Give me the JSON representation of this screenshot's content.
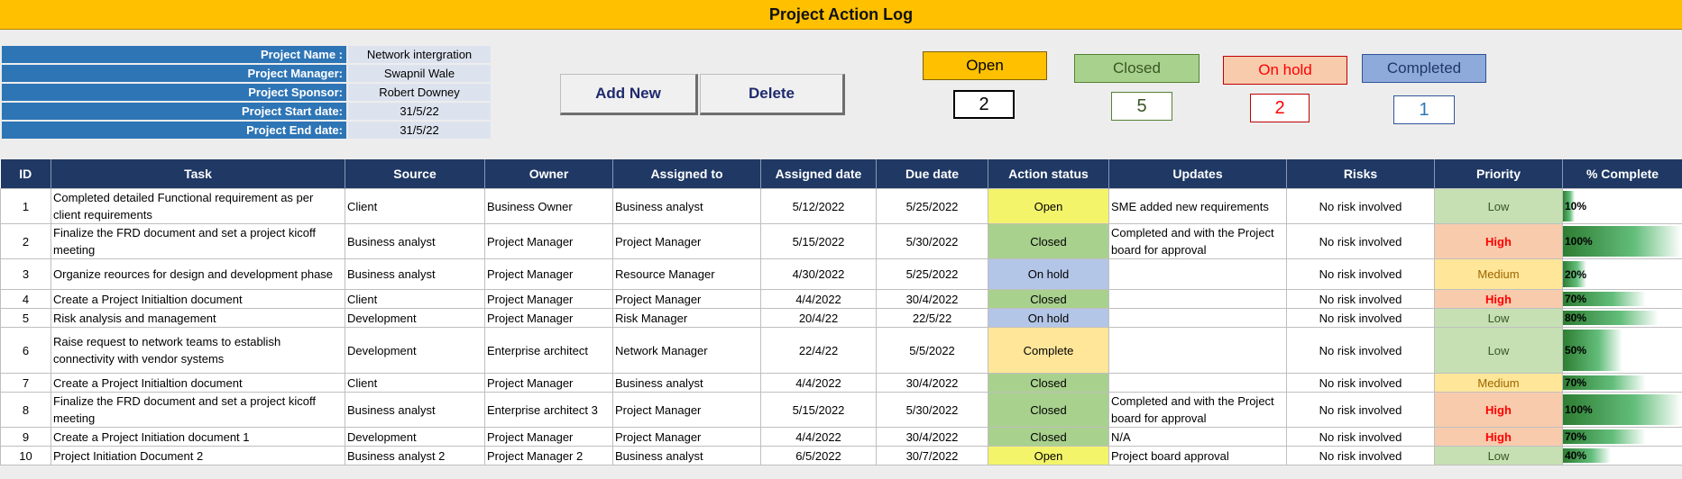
{
  "title": "Project Action Log",
  "info": [
    {
      "label": "Project Name :",
      "value": "Network intergration"
    },
    {
      "label": "Project Manager:",
      "value": "Swapnil Wale"
    },
    {
      "label": "Project Sponsor:",
      "value": "Robert Downey"
    },
    {
      "label": "Project Start  date:",
      "value": "31/5/22"
    },
    {
      "label": "Project End date:",
      "value": "31/5/22"
    }
  ],
  "buttons": {
    "add": "Add New",
    "delete": "Delete"
  },
  "stats": {
    "open": {
      "label": "Open",
      "count": "2",
      "bg": "#ffc000",
      "color": "#000000"
    },
    "closed": {
      "label": "Closed",
      "count": "5",
      "bg": "#a9d18e",
      "color": "#375623"
    },
    "onhold": {
      "label": "On hold",
      "count": "2",
      "bg": "#f8cbad",
      "color": "#ff0000"
    },
    "completed": {
      "label": "Completed",
      "count": "1",
      "bg": "#8eaadb",
      "color": "#2e75b6"
    }
  },
  "columns": [
    "ID",
    "Task",
    "Source",
    "Owner",
    "Assigned to",
    "Assigned date",
    "Due date",
    "Action status",
    "Updates",
    "Risks",
    "Priority",
    "% Complete"
  ],
  "rows": [
    {
      "id": "1",
      "task": "Completed detailed Functional requirement as per client requirements",
      "source": "Client",
      "owner": "Business Owner",
      "assigned": "Business analyst",
      "adate": "5/12/2022",
      "due": "5/25/2022",
      "status": "Open",
      "updates": "SME added new requirements",
      "risks": "No risk involved",
      "priority": "Low",
      "pct": "10%",
      "pval": 10
    },
    {
      "id": "2",
      "task": "Finalize the FRD document and set a project kicoff meeting",
      "source": "Business analyst",
      "owner": "Project Manager",
      "assigned": "Project Manager",
      "adate": "5/15/2022",
      "due": "5/30/2022",
      "status": "Closed",
      "updates": "Completed and with the Project board for approval",
      "risks": "No risk involved",
      "priority": "High",
      "pct": "100%",
      "pval": 100
    },
    {
      "id": "3",
      "task": "Organize reources for design and development phase",
      "source": "Business analyst",
      "owner": "Project Manager",
      "assigned": "Resource Manager",
      "adate": "4/30/2022",
      "due": "5/25/2022",
      "status": "On hold",
      "updates": "",
      "risks": "No risk involved",
      "priority": "Medium",
      "pct": "20%",
      "pval": 20
    },
    {
      "id": "4",
      "task": "Create a Project Initialtion document",
      "source": "Client",
      "owner": "Project Manager",
      "assigned": "Project Manager",
      "adate": "4/4/2022",
      "due": "30/4/2022",
      "status": "Closed",
      "updates": "",
      "risks": "No risk involved",
      "priority": "High",
      "pct": "70%",
      "pval": 70
    },
    {
      "id": "5",
      "task": "Risk analysis and  management",
      "source": "Development",
      "owner": "Project Manager",
      "assigned": "Risk Manager",
      "adate": "20/4/22",
      "due": "22/5/22",
      "status": "On hold",
      "updates": "",
      "risks": "No risk involved",
      "priority": "Low",
      "pct": "80%",
      "pval": 80
    },
    {
      "id": "6",
      "task": "Raise request to network teams to establish connectivity with vendor systems",
      "source": "Development",
      "owner": "Enterprise architect",
      "assigned": "Network Manager",
      "adate": "22/4/22",
      "due": "5/5/2022",
      "status": "Complete",
      "updates": "",
      "risks": "No risk involved",
      "priority": "Low",
      "pct": "50%",
      "pval": 50
    },
    {
      "id": "7",
      "task": "Create a Project Initialtion document",
      "source": "Client",
      "owner": "Project Manager",
      "assigned": "Business analyst",
      "adate": "4/4/2022",
      "due": "30/4/2022",
      "status": "Closed",
      "updates": "",
      "risks": "No risk involved",
      "priority": "Medium",
      "pct": "70%",
      "pval": 70
    },
    {
      "id": "8",
      "task": "Finalize the FRD document and set a project kicoff meeting",
      "source": "Business analyst",
      "owner": "Enterprise architect 3",
      "assigned": "Project Manager",
      "adate": "5/15/2022",
      "due": "5/30/2022",
      "status": "Closed",
      "updates": "Completed and with the Project board for approval",
      "risks": "No risk involved",
      "priority": "High",
      "pct": "100%",
      "pval": 100
    },
    {
      "id": "9",
      "task": "Create a Project Initiation document 1",
      "source": "Development",
      "owner": "Project Manager",
      "assigned": "Project Manager",
      "adate": "4/4/2022",
      "due": "30/4/2022",
      "status": "Closed",
      "updates": "N/A",
      "risks": "No risk involved",
      "priority": "High",
      "pct": "70%",
      "pval": 70
    },
    {
      "id": "10",
      "task": "Project Initiation Document 2",
      "source": "Business analyst 2",
      "owner": "Project Manager 2",
      "assigned": "Business analyst",
      "adate": "6/5/2022",
      "due": "30/7/2022",
      "status": "Open",
      "updates": "Project board approval",
      "risks": "No risk involved",
      "priority": "Low",
      "pct": "40%",
      "pval": 40
    }
  ]
}
